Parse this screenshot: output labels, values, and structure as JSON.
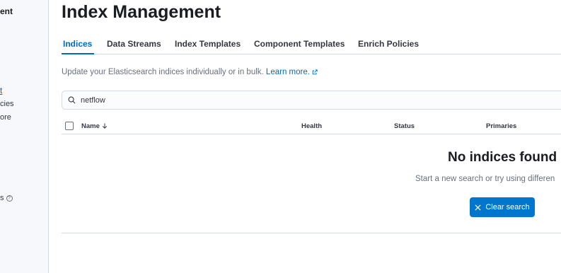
{
  "sidebar": {
    "heading": "ent",
    "active_item": "t",
    "item_policies": "cies",
    "item_more": "ore",
    "item_help": "s"
  },
  "page": {
    "title": "Index Management"
  },
  "tabs": [
    {
      "label": "Indices",
      "active": true
    },
    {
      "label": "Data Streams",
      "active": false
    },
    {
      "label": "Index Templates",
      "active": false
    },
    {
      "label": "Component Templates",
      "active": false
    },
    {
      "label": "Enrich Policies",
      "active": false
    }
  ],
  "description": {
    "text": "Update your Elasticsearch indices individually or in bulk. ",
    "link": "Learn more."
  },
  "search": {
    "value": "netflow"
  },
  "table": {
    "columns": [
      "Name",
      "Health",
      "Status",
      "Primaries"
    ]
  },
  "empty_state": {
    "title": "No indices found",
    "subtitle": "Start a new search or try using differen",
    "button": "Clear search"
  },
  "colors": {
    "accent": "#006bb8",
    "button": "#0077cc"
  }
}
